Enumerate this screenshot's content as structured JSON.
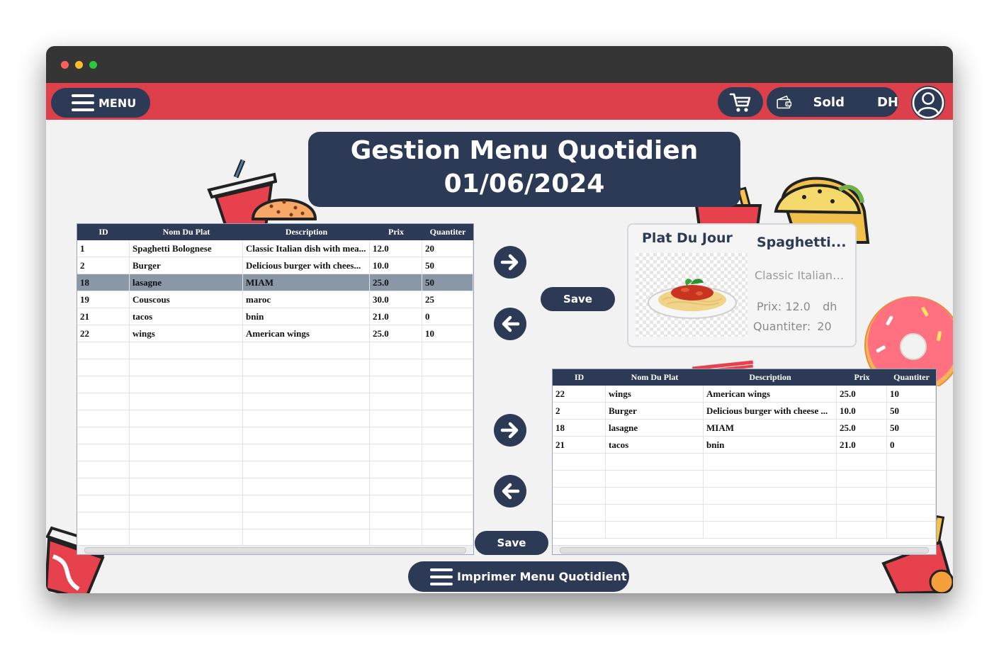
{
  "window": {
    "controls": [
      "close",
      "minimize",
      "maximize"
    ],
    "colors": {
      "close": "#fe5f57",
      "minimize": "#febc2e",
      "maximize": "#28c840"
    }
  },
  "topbar": {
    "menu_label": "MENU",
    "sold_label": "Sold",
    "currency_label": "DH",
    "icons": [
      "menu-icon",
      "cart-icon",
      "wallet-icon",
      "user-icon"
    ],
    "accent_color": "#de404b",
    "primary_color": "#2d3a56"
  },
  "heading": {
    "title": "Gestion Menu Quotidien",
    "date": "01/06/2024"
  },
  "left_table": {
    "columns": [
      "ID",
      "Nom Du Plat",
      "Description",
      "Prix",
      "Quantiter"
    ],
    "rows": [
      [
        "1",
        "Spaghetti Bolognese",
        "Classic Italian dish with mea...",
        "12.0",
        "20"
      ],
      [
        "2",
        "Burger",
        "Delicious burger with chees...",
        "10.0",
        "50"
      ],
      [
        "18",
        "lasagne",
        "MIAM",
        "25.0",
        "50"
      ],
      [
        "19",
        "Couscous",
        "maroc",
        "30.0",
        "25"
      ],
      [
        "21",
        "tacos",
        "bnin",
        "21.0",
        "0"
      ],
      [
        "22",
        "wings",
        "American wings",
        "25.0",
        "10"
      ]
    ],
    "selected_row": 2
  },
  "right_table": {
    "columns": [
      "ID",
      "Nom Du Plat",
      "Description",
      "Prix",
      "Quantiter"
    ],
    "rows": [
      [
        "22",
        "wings",
        "American wings",
        "25.0",
        "10"
      ],
      [
        "2",
        "Burger",
        "Delicious burger with cheese ...",
        "10.0",
        "50"
      ],
      [
        "18",
        "lasagne",
        "MIAM",
        "25.0",
        "50"
      ],
      [
        "21",
        "tacos",
        "bnin",
        "21.0",
        "0"
      ]
    ]
  },
  "plat_du_jour": {
    "title": "Plat Du Jour",
    "name": "Spaghetti...",
    "description": "Classic Italian ...",
    "prix_label": "Prix:",
    "prix_value": "12.0",
    "prix_unit": "dh",
    "quantiter_label": "Quantiter:",
    "quantiter_value": "20"
  },
  "buttons": {
    "save_top": "Save",
    "save_bottom": "Save",
    "print": "Imprimer Menu Quotidient"
  }
}
